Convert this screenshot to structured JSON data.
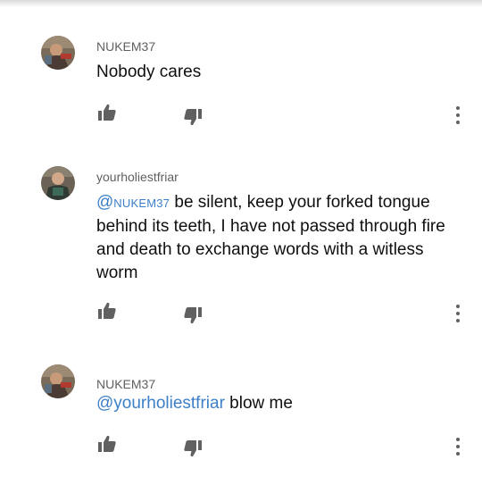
{
  "comments": [
    {
      "author": "NUKEM37",
      "text": "Nobody cares",
      "mention_at": "",
      "mention": "",
      "avatar": "avatar-nukem37"
    },
    {
      "author": "yourholiestfriar",
      "mention_at": "@",
      "mention": "NUKEM37",
      "text": " be silent, keep your forked tongue behind its teeth, I have not passed through fire and death to exchange words with a witless worm",
      "avatar": "avatar-friar"
    },
    {
      "author": "NUKEM37",
      "mention_at": "@",
      "mention": "yourholiestfriar",
      "text": " blow me",
      "avatar": "avatar-nukem37"
    }
  ],
  "icons": {
    "like": "thumbs-up-icon",
    "dislike": "thumbs-down-icon",
    "more": "more-vert-icon"
  },
  "colors": {
    "author": "#606060",
    "text": "#0f0f0f",
    "mention": "#3c7fc8",
    "icon": "#606060"
  }
}
